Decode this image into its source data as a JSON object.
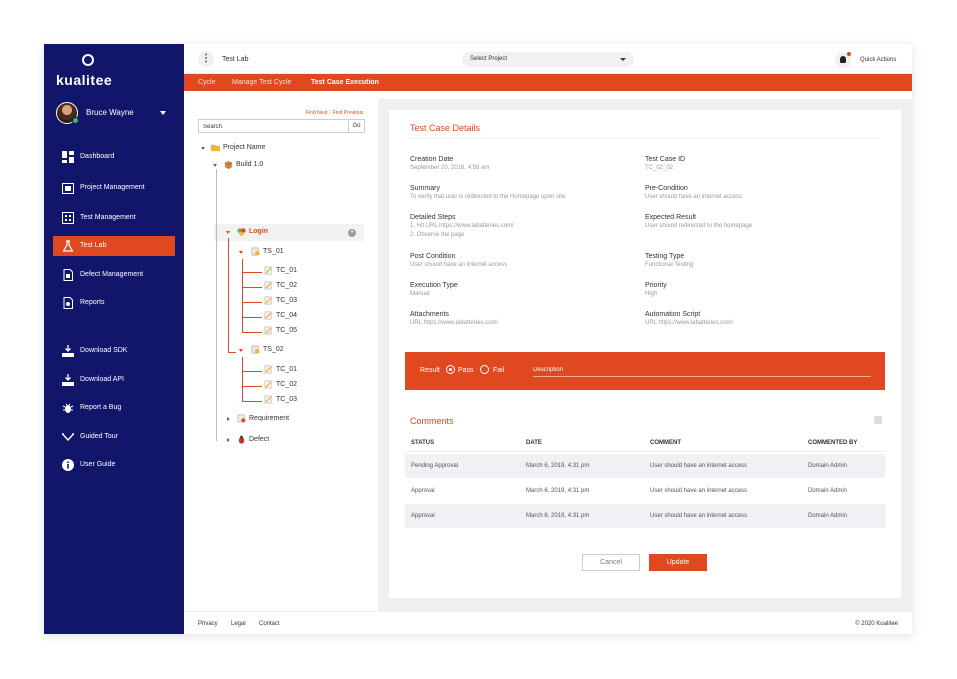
{
  "sidebar": {
    "logo_text": "kualitee",
    "user_name": "Bruce Wayne",
    "items": [
      {
        "label": "Dashboard",
        "icon": "dashboard-icon"
      },
      {
        "label": "Project Management",
        "icon": "project-icon"
      },
      {
        "label": "Test Management",
        "icon": "test-management-icon"
      },
      {
        "label": "Test Lab",
        "icon": "flask-icon",
        "active": true
      },
      {
        "label": "Defect Management",
        "icon": "defect-icon"
      },
      {
        "label": "Reports",
        "icon": "reports-icon"
      },
      {
        "label": "Download SDK",
        "icon": "download-icon"
      },
      {
        "label": "Download API",
        "icon": "download-icon"
      },
      {
        "label": "Report a Bug",
        "icon": "bug-icon"
      },
      {
        "label": "Guided Tour",
        "icon": "tour-icon"
      },
      {
        "label": "User Guide",
        "icon": "info-icon"
      }
    ]
  },
  "header": {
    "title": "Test Lab",
    "project_select": "Select Project",
    "quick_actions": "Quick Actions"
  },
  "tabs": [
    "Cycle",
    "Manage Test Cycle",
    "Test Case Execution"
  ],
  "tree": {
    "find_next": "Find Next",
    "find_previous": "Find Previous",
    "search_placeholder": "Search",
    "go": "Go",
    "project": "Project Name",
    "build": "Build 1.0",
    "module": "Login",
    "ts1": "TS_01",
    "ts1_cases": [
      "TC_01",
      "TC_02",
      "TC_03",
      "TC_04",
      "TC_05"
    ],
    "ts2": "TS_02",
    "ts2_cases": [
      "TC_01",
      "TC_02",
      "TC_03"
    ],
    "requirement": "Requirement",
    "defect": "Defect"
  },
  "details": {
    "title": "Test Case Details",
    "fields": [
      {
        "k": "Creation Date",
        "v": "September 20, 2016, 4:58 am"
      },
      {
        "k": "Test Case ID",
        "v": "TC_02_02"
      },
      {
        "k": "Summary",
        "v": "To verify that user is redirected to the Homepage upon site"
      },
      {
        "k": "Pre-Condition",
        "v": "User should have an internet access"
      },
      {
        "k": "Detailed Steps",
        "v": "1. Hit URL https://www.labatteries.com/",
        "v2": "2. Observe the page"
      },
      {
        "k": "Expected Result",
        "v": "User should redirected to the homepage"
      },
      {
        "k": "Post Condition",
        "v": "User should have an internet access"
      },
      {
        "k": "Testing Type",
        "v": "Functional Testing"
      },
      {
        "k": "Execution Type",
        "v": "Manual"
      },
      {
        "k": "Priority",
        "v": "High"
      },
      {
        "k": "Attachments",
        "v": "URL https://www.labatteries.com/"
      },
      {
        "k": "Automation Script",
        "v": "URL https://www.labatteries.com/"
      }
    ]
  },
  "result": {
    "label": "Result",
    "pass": "Pass",
    "fail": "Fail",
    "description_placeholder": "Description"
  },
  "comments": {
    "title": "Comments",
    "headers": [
      "STATUS",
      "DATE",
      "COMMENT",
      "COMMENTED BY"
    ],
    "rows": [
      [
        "Pending Approval",
        "March 6, 2019, 4:31 pm",
        "User should have an internet access",
        "Domain Admin"
      ],
      [
        "Approval",
        "March 6, 2019, 4:31 pm",
        "User should have an internet access",
        "Domain Admin"
      ],
      [
        "Approval",
        "March 6, 2019, 4:31 pm",
        "User should have an internet access",
        "Domain Admin"
      ]
    ]
  },
  "actions": {
    "cancel": "Cancel",
    "update": "Update"
  },
  "footer": {
    "links": [
      "Privacy",
      "Legal",
      "Contact"
    ],
    "copyright": "© 2020 Kualitee"
  },
  "colors": {
    "accent": "#e0481f",
    "sidebar": "#12166b"
  }
}
